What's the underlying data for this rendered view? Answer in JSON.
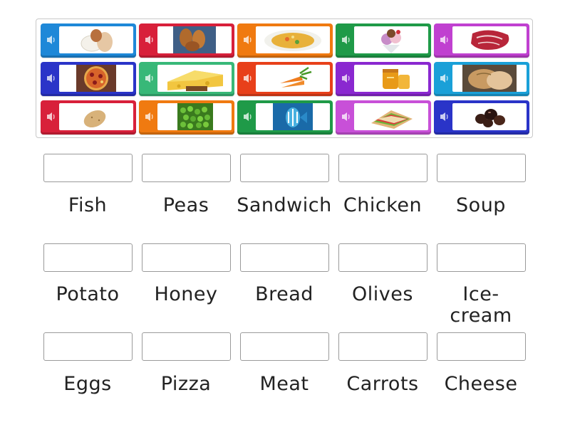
{
  "tiles": [
    {
      "icon": "eggs-image",
      "color": "#1e88d8"
    },
    {
      "icon": "chicken-image",
      "color": "#d8203a"
    },
    {
      "icon": "soup-image",
      "color": "#f07a10"
    },
    {
      "icon": "ice-cream-image",
      "color": "#1f9a48"
    },
    {
      "icon": "meat-image",
      "color": "#c040d0"
    },
    {
      "icon": "pizza-image",
      "color": "#2a34c8"
    },
    {
      "icon": "cheese-image",
      "color": "#38b878"
    },
    {
      "icon": "carrots-image",
      "color": "#e8401a"
    },
    {
      "icon": "honey-image",
      "color": "#8a28d0"
    },
    {
      "icon": "bread-image",
      "color": "#1aa0d8"
    },
    {
      "icon": "potato-image",
      "color": "#d8203a"
    },
    {
      "icon": "peas-image",
      "color": "#f07a10"
    },
    {
      "icon": "fish-image",
      "color": "#1f9a48"
    },
    {
      "icon": "sandwich-image",
      "color": "#c850d8"
    },
    {
      "icon": "olives-image",
      "color": "#2a34c8"
    }
  ],
  "targets": {
    "labels": [
      "Fish",
      "Peas",
      "Sandwich",
      "Chicken",
      "Soup",
      "Potato",
      "Honey",
      "Bread",
      "Olives",
      "Ice-cream",
      "Eggs",
      "Pizza",
      "Meat",
      "Carrots",
      "Cheese"
    ]
  }
}
